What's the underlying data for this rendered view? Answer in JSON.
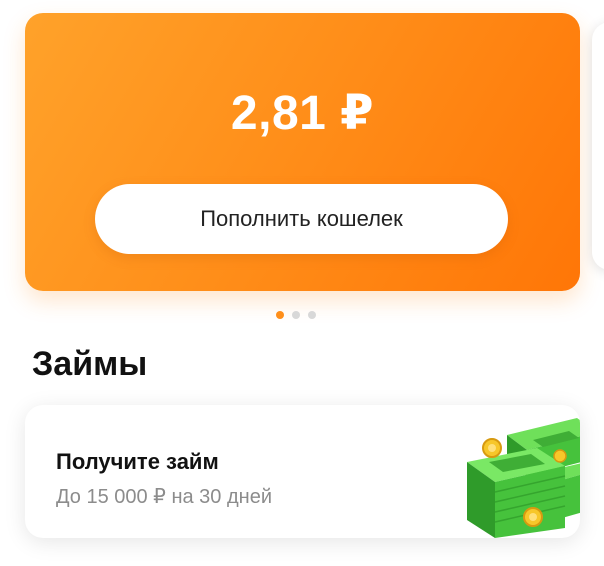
{
  "wallet": {
    "balance": "2,81 ₽",
    "topup_label": "Пополнить кошелек",
    "pager": {
      "count": 3,
      "active": 0
    },
    "gradient_colors": [
      "#ffa22a",
      "#ff7607"
    ]
  },
  "loans": {
    "section_title": "Займы",
    "card": {
      "title": "Получите займ",
      "subtitle": "До 15 000 ₽ на 30 дней",
      "illustration": "money-stack-icon"
    }
  },
  "colors": {
    "accent": "#ff8f1a",
    "text_primary": "#111111",
    "text_secondary": "#8c8c8c"
  }
}
